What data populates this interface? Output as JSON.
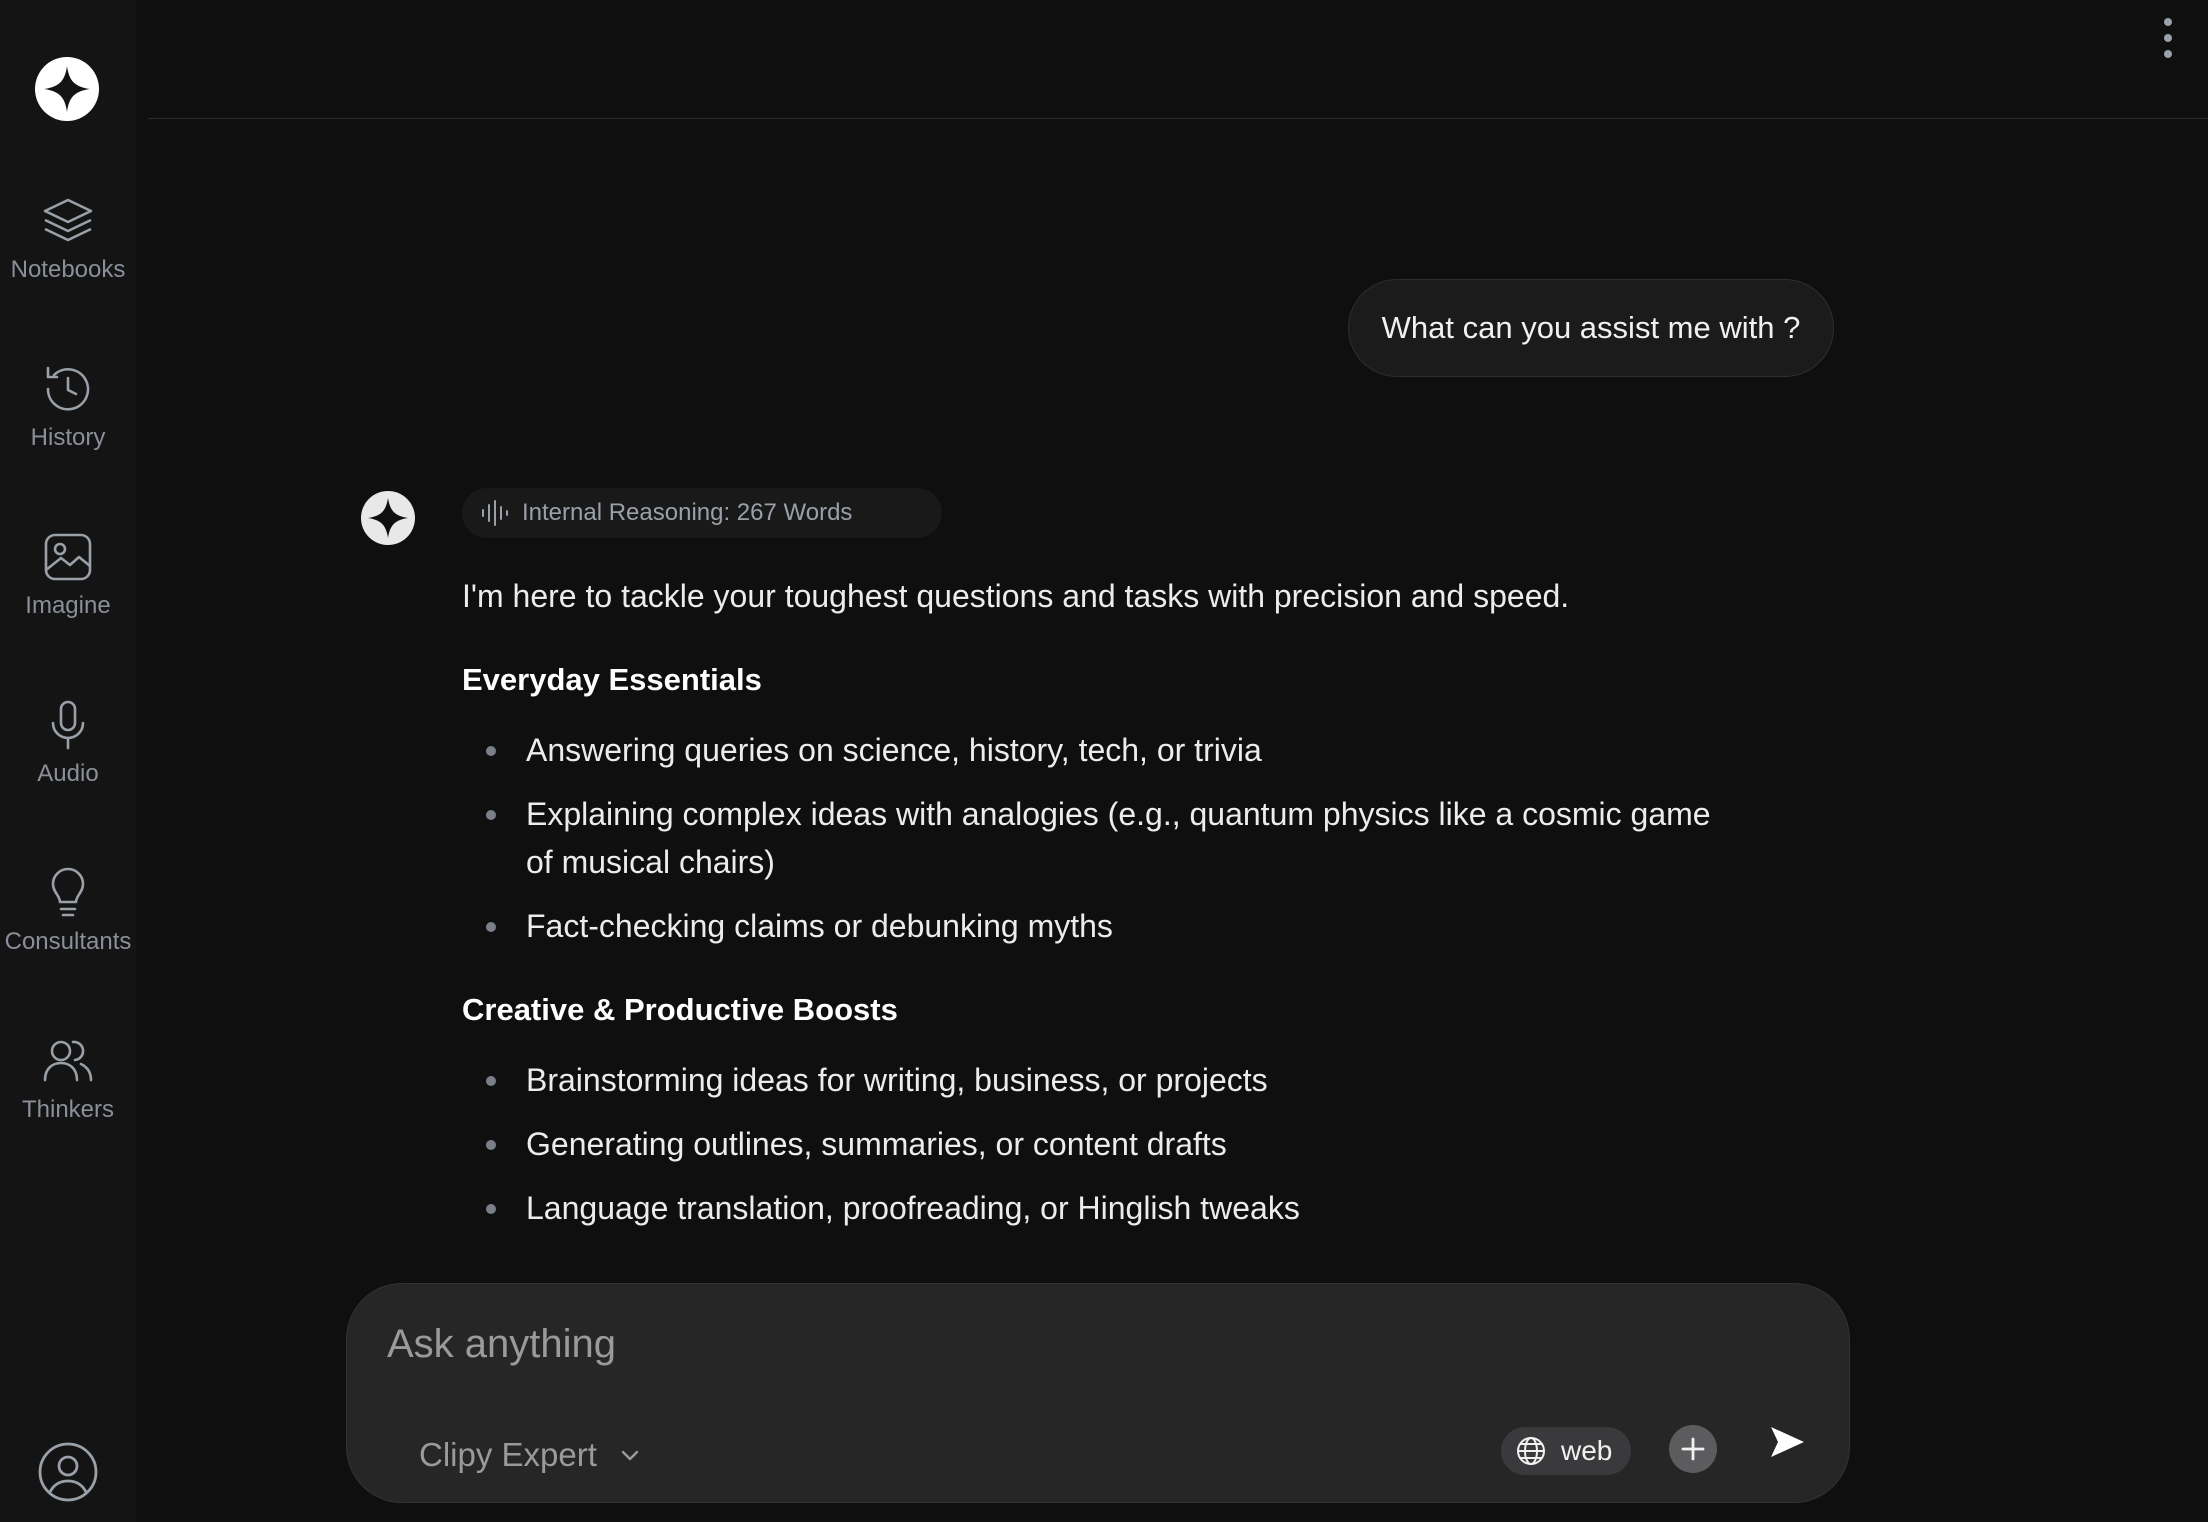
{
  "sidebar": {
    "logo_icon": "sparkle-logo-icon",
    "items": [
      {
        "label": "Notebooks",
        "icon": "layers-icon"
      },
      {
        "label": "History",
        "icon": "history-clock-icon"
      },
      {
        "label": "Imagine",
        "icon": "image-icon"
      },
      {
        "label": "Audio",
        "icon": "microphone-icon"
      },
      {
        "label": "Consultants",
        "icon": "lightbulb-icon"
      },
      {
        "label": "Thinkers",
        "icon": "users-icon"
      }
    ],
    "profile_icon": "user-circle-icon"
  },
  "topbar": {
    "menu_icon": "kebab-menu-icon"
  },
  "chat": {
    "user_message": "What can you assist me with ?",
    "reasoning_label": "Internal Reasoning: 267 Words",
    "answer": {
      "intro": "I'm here to tackle your toughest questions and tasks with precision and speed.",
      "sections": [
        {
          "heading": "Everyday Essentials",
          "items": [
            "Answering queries on science, history, tech, or trivia",
            "Explaining complex ideas with analogies (e.g., quantum physics like a cosmic game of musical chairs)",
            "Fact-checking claims or debunking myths"
          ]
        },
        {
          "heading": "Creative & Productive Boosts",
          "items": [
            "Brainstorming ideas for writing, business, or projects",
            "Generating outlines, summaries, or content drafts",
            "Language translation, proofreading, or Hinglish tweaks"
          ]
        }
      ]
    }
  },
  "composer": {
    "placeholder": "Ask anything",
    "model": "Clipy Expert",
    "web_label": "web"
  },
  "colors": {
    "background": "#0f0f10",
    "sidebar": "#141414",
    "composer": "#262627",
    "muted_text": "#8a8f99"
  }
}
